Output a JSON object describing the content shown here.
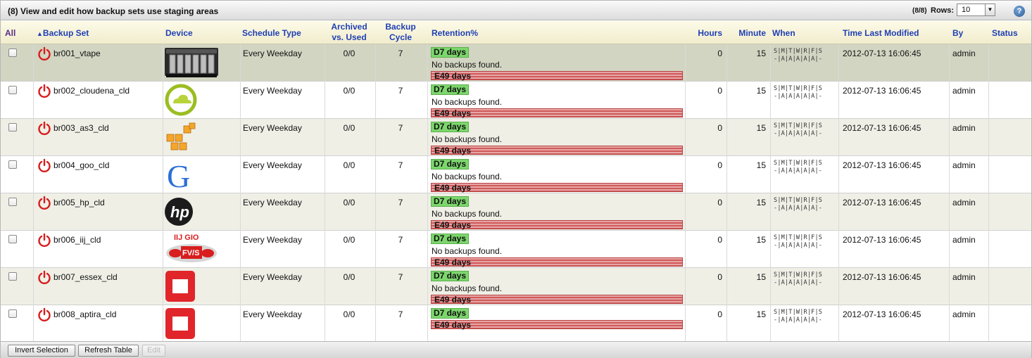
{
  "title": "(8) View and edit how backup sets use staging areas",
  "pager": {
    "count": "(8/8)",
    "rows_label": "Rows:",
    "rows_value": "10"
  },
  "help_icon": "help-icon",
  "columns": {
    "all": "All",
    "backup_set": "Backup Set",
    "device": "Device",
    "schedule_type": "Schedule Type",
    "archived_1": "Archived",
    "archived_2": "vs. Used",
    "cycle_1": "Backup",
    "cycle_2": "Cycle",
    "retention": "Retention%",
    "hours": "Hours",
    "minute": "Minute",
    "when": "When",
    "time_last_modified": "Time Last Modified",
    "by": "By",
    "status": "Status"
  },
  "sort": {
    "column": "backup_set",
    "direction": "ascending"
  },
  "rows": [
    {
      "name": "br001_vtape",
      "device": "vtape",
      "schedule": "Every Weekday",
      "archived": "0/0",
      "cycle": "7",
      "d_label": "D7 days",
      "no_backups": "No backups found.",
      "e_label": "E49 days",
      "hours": "0",
      "minute": "15",
      "when_1": "S|M|T|W|R|F|S",
      "when_2": "-|A|A|A|A|A|-",
      "modified": "2012-07-13 16:06:45",
      "by": "admin",
      "status": ""
    },
    {
      "name": "br002_cloudena_cld",
      "device": "cloudena",
      "schedule": "Every Weekday",
      "archived": "0/0",
      "cycle": "7",
      "d_label": "D7 days",
      "no_backups": "No backups found.",
      "e_label": "E49 days",
      "hours": "0",
      "minute": "15",
      "when_1": "S|M|T|W|R|F|S",
      "when_2": "-|A|A|A|A|A|-",
      "modified": "2012-07-13 16:06:45",
      "by": "admin",
      "status": ""
    },
    {
      "name": "br003_as3_cld",
      "device": "amazon-s3",
      "schedule": "Every Weekday",
      "archived": "0/0",
      "cycle": "7",
      "d_label": "D7 days",
      "no_backups": "No backups found.",
      "e_label": "E49 days",
      "hours": "0",
      "minute": "15",
      "when_1": "S|M|T|W|R|F|S",
      "when_2": "-|A|A|A|A|A|-",
      "modified": "2012-07-13 16:06:45",
      "by": "admin",
      "status": ""
    },
    {
      "name": "br004_goo_cld",
      "device": "google",
      "schedule": "Every Weekday",
      "archived": "0/0",
      "cycle": "7",
      "d_label": "D7 days",
      "no_backups": "No backups found.",
      "e_label": "E49 days",
      "hours": "0",
      "minute": "15",
      "when_1": "S|M|T|W|R|F|S",
      "when_2": "-|A|A|A|A|A|-",
      "modified": "2012-07-13 16:06:45",
      "by": "admin",
      "status": ""
    },
    {
      "name": "br005_hp_cld",
      "device": "hp",
      "schedule": "Every Weekday",
      "archived": "0/0",
      "cycle": "7",
      "d_label": "D7 days",
      "no_backups": "No backups found.",
      "e_label": "E49 days",
      "hours": "0",
      "minute": "15",
      "when_1": "S|M|T|W|R|F|S",
      "when_2": "-|A|A|A|A|A|-",
      "modified": "2012-07-13 16:06:45",
      "by": "admin",
      "status": ""
    },
    {
      "name": "br006_iij_cld",
      "device": "iij-gio",
      "device_text_1": "IIJ GIO",
      "device_text_2": "FV/S",
      "schedule": "Every Weekday",
      "archived": "0/0",
      "cycle": "7",
      "d_label": "D7 days",
      "no_backups": "No backups found.",
      "e_label": "E49 days",
      "hours": "0",
      "minute": "15",
      "when_1": "S|M|T|W|R|F|S",
      "when_2": "-|A|A|A|A|A|-",
      "modified": "2012-07-13 16:06:45",
      "by": "admin",
      "status": ""
    },
    {
      "name": "br007_essex_cld",
      "device": "openstack",
      "schedule": "Every Weekday",
      "archived": "0/0",
      "cycle": "7",
      "d_label": "D7 days",
      "no_backups": "No backups found.",
      "e_label": "E49 days",
      "hours": "0",
      "minute": "15",
      "when_1": "S|M|T|W|R|F|S",
      "when_2": "-|A|A|A|A|A|-",
      "modified": "2012-07-13 16:06:45",
      "by": "admin",
      "status": ""
    },
    {
      "name": "br008_aptira_cld",
      "device": "openstack",
      "schedule": "Every Weekday",
      "archived": "0/0",
      "cycle": "7",
      "d_label": "D7 days",
      "no_backups": "",
      "e_label": "E49 days",
      "hours": "0",
      "minute": "15",
      "when_1": "S|M|T|W|R|F|S",
      "when_2": "-|A|A|A|A|A|-",
      "modified": "2012-07-13 16:06:45",
      "by": "admin",
      "status": ""
    }
  ],
  "footer": {
    "invert": "Invert Selection",
    "refresh": "Refresh Table",
    "edit": "Edit"
  },
  "colors": {
    "header_text": "#1f3fb4",
    "power_icon": "#d81e1e",
    "retention_ok": "#7cd66c",
    "retention_expire": "#d05a5a"
  }
}
